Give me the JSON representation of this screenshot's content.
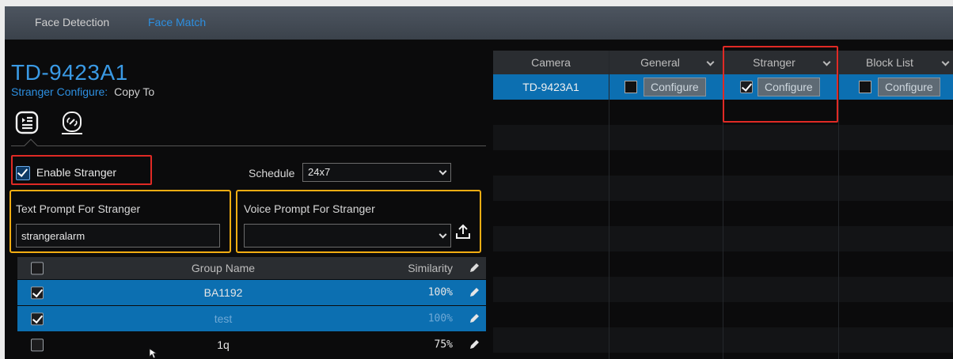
{
  "tabs": [
    {
      "label": "Face Detection",
      "active": false
    },
    {
      "label": "Face Match",
      "active": true
    }
  ],
  "camera_title": "TD-9423A1",
  "stranger_configure": {
    "label": "Stranger Configure:",
    "copy_to": "Copy To"
  },
  "icons": [
    "list-settings-icon",
    "link-icon"
  ],
  "enable_stranger": {
    "label": "Enable Stranger",
    "checked": true
  },
  "schedule": {
    "label": "Schedule",
    "value": "24x7"
  },
  "text_prompt": {
    "label": "Text Prompt For Stranger",
    "value": "strangeralarm"
  },
  "voice_prompt": {
    "label": "Voice Prompt For Stranger",
    "value": ""
  },
  "group_table": {
    "headers": {
      "name": "Group Name",
      "similarity": "Similarity"
    },
    "rows": [
      {
        "name": "BA1192",
        "similarity": "100%",
        "checked": true
      },
      {
        "name": "test",
        "similarity": "100%",
        "checked": true
      },
      {
        "name": "1q",
        "similarity": "75%",
        "checked": false
      }
    ]
  },
  "camera_table": {
    "headers": [
      "Camera",
      "General",
      "Stranger",
      "Block List"
    ],
    "rows": [
      {
        "camera": "TD-9423A1",
        "general_checked": false,
        "stranger_checked": true,
        "blocklist_checked": false
      }
    ],
    "configure_label": "Configure"
  },
  "colors": {
    "accent": "#2d8fe0",
    "selected_row": "#0c6fb1",
    "highlight_red": "#e02a25",
    "highlight_yellow": "#f2ad12"
  }
}
